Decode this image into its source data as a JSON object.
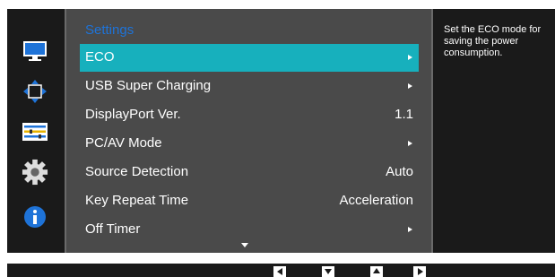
{
  "sidebar": {
    "icons": [
      "picture-icon",
      "onscreen-display-icon",
      "setup-reset-icon",
      "system-gear-icon",
      "information-icon"
    ]
  },
  "menu": {
    "title": "Settings",
    "items": [
      {
        "label": "ECO",
        "value": "",
        "arrow": true,
        "selected": true
      },
      {
        "label": "USB Super Charging",
        "value": "",
        "arrow": true,
        "selected": false
      },
      {
        "label": "DisplayPort Ver.",
        "value": "1.1",
        "arrow": false,
        "selected": false
      },
      {
        "label": "PC/AV Mode",
        "value": "",
        "arrow": true,
        "selected": false
      },
      {
        "label": "Source Detection",
        "value": "Auto",
        "arrow": false,
        "selected": false
      },
      {
        "label": "Key Repeat Time",
        "value": "Acceleration",
        "arrow": false,
        "selected": false
      },
      {
        "label": "Off Timer",
        "value": "",
        "arrow": true,
        "selected": false
      }
    ]
  },
  "help": {
    "text": "Set the ECO mode for saving the power consumption."
  },
  "navbar": {
    "keys": [
      "left-key",
      "down-key",
      "up-key",
      "right-key"
    ]
  },
  "colors": {
    "selected_item": "#17b0bd",
    "title_blue": "#1e73d8",
    "panel": "#4a4a4a",
    "background": "#1a1a1a"
  }
}
